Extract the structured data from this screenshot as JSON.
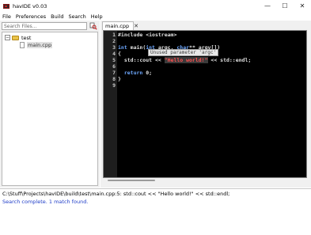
{
  "window": {
    "title": "havIDE v0.03",
    "controls": {
      "minimize": "—",
      "maximize": "☐",
      "close": "✕"
    }
  },
  "menu": [
    "File",
    "Preferences",
    "Build",
    "Search",
    "Help"
  ],
  "sidebar": {
    "search_placeholder": "Search Files...",
    "search_button_icon": "find-icon",
    "tree": {
      "root": {
        "toggle": "−",
        "label": "test",
        "icon": "folder-icon"
      },
      "children": [
        {
          "label": "main.cpp",
          "icon": "file-icon",
          "selected": true
        }
      ]
    }
  },
  "editor": {
    "tab": {
      "label": "main.cpp",
      "close": "✕"
    },
    "line_numbers": [
      "1",
      "2",
      "3",
      "4",
      "5",
      "6",
      "7",
      "8",
      "9"
    ],
    "code": {
      "l1_a": "#include ",
      "l1_b": "<iostream>",
      "l3_kw1": "int",
      "l3_a": " main(",
      "l3_kw2": "int",
      "l3_b": " argc, ",
      "l3_kw3": "char",
      "l3_c": "** argv[])",
      "l4": "{",
      "l5_a": "  std::cout << ",
      "l5_str": "\"Hello world!\"",
      "l5_b": " << std::endl;",
      "l7_kw": "return",
      "l7_b": " 0;",
      "l8": "}"
    },
    "tooltip": "Unused parameter 'argc'"
  },
  "output": {
    "line1": "C:\\Stuff\\Projects\\havIDE\\build\\test\\main.cpp:5:    std::cout << \"Hello world!\" << std::endl;",
    "line2": "Search complete. 1 match found."
  },
  "colors": {
    "editor_bg": "#000000",
    "keyword": "#6ea8ff",
    "string": "#ff5050",
    "status_blue": "#1e3cc8"
  }
}
